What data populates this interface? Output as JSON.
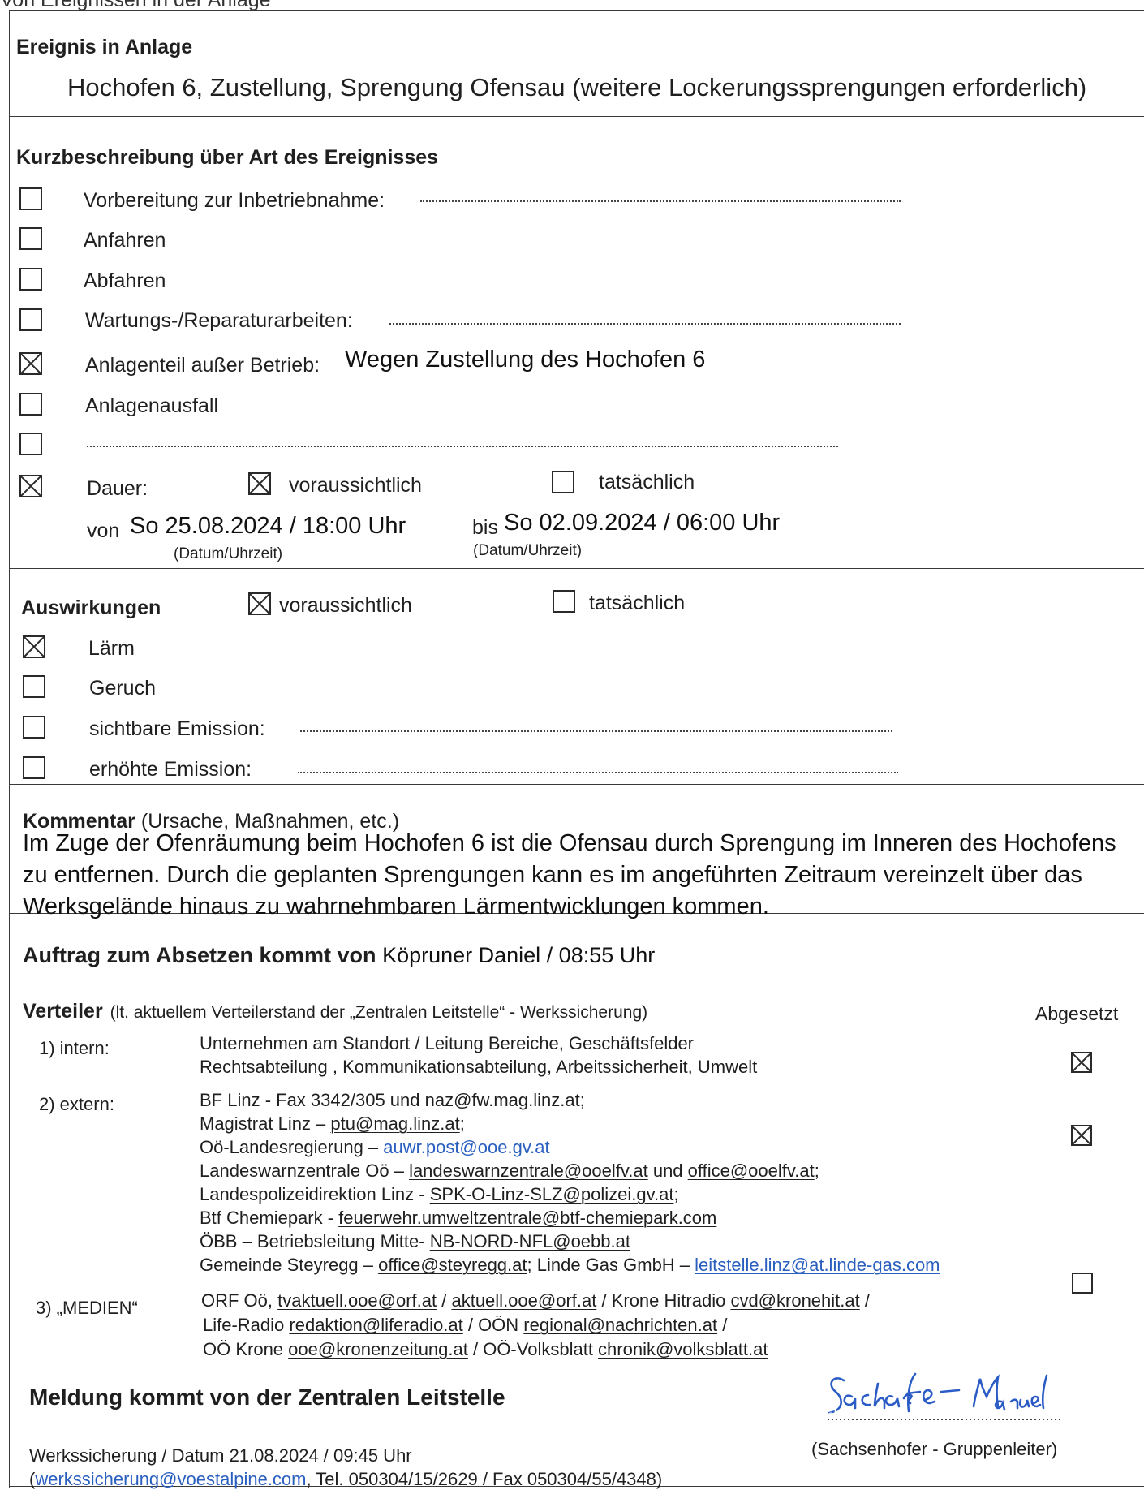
{
  "top_cut": "Von Ereignissen in der Anlage",
  "event": {
    "heading": "Ereignis in Anlage",
    "value": "Hochofen 6, Zustellung, Sprengung Ofensau (weitere Lockerungssprengungen erforderlich)"
  },
  "kurz": {
    "heading": "Kurzbeschreibung über Art des Ereignisses",
    "items": [
      {
        "label": "Vorbereitung zur Inbetriebnahme:",
        "checked": false
      },
      {
        "label": "Anfahren",
        "checked": false
      },
      {
        "label": "Abfahren",
        "checked": false
      },
      {
        "label": "Wartungs-/Reparaturarbeiten:",
        "checked": false
      },
      {
        "label": "Anlagenteil außer Betrieb:",
        "value": "Wegen Zustellung des Hochofen 6",
        "checked": true
      },
      {
        "label": "Anlagenausfall",
        "checked": false
      },
      {
        "label": "",
        "checked": false
      }
    ],
    "dauer": {
      "label": "Dauer:",
      "checked": true,
      "voraus": "voraussichtlich",
      "voraus_checked": true,
      "tats": "tatsächlich",
      "tats_checked": false,
      "von_label": "von",
      "von_value": "So 25.08.2024 / 18:00 Uhr",
      "bis_label": "bis",
      "bis_value": "So 02.09.2024 / 06:00 Uhr",
      "datum_hint": "(Datum/Uhrzeit)",
      "datum_hint2": "(Datum/Uhrzeit)"
    }
  },
  "ausw": {
    "heading": "Auswirkungen",
    "voraus": "voraussichtlich",
    "tats": "tatsächlich",
    "items": [
      {
        "label": "Lärm",
        "checked": true
      },
      {
        "label": "Geruch",
        "checked": false
      },
      {
        "label": "sichtbare Emission:",
        "checked": false
      },
      {
        "label": "erhöhte Emission:",
        "checked": false
      }
    ]
  },
  "kommentar": {
    "heading": "Kommentar",
    "heading_suffix": " (Ursache, Maßnahmen, etc.)",
    "lines": [
      "Im Zuge der Ofenräumung beim Hochofen 6 ist die Ofensau durch Sprengung im Inneren des Hochofens",
      "zu entfernen. Durch die geplanten Sprengungen kann es im angeführten Zeitraum vereinzelt über das",
      "Werksgelände hinaus zu wahrnehmbaren Lärmentwicklungen kommen."
    ]
  },
  "auftrag": {
    "label": "Auftrag zum Absetzen kommt von",
    "value": "Köpruner Daniel / 08:55 Uhr"
  },
  "verteiler": {
    "heading": "Verteiler",
    "subtitle": "(lt. aktuellem Verteilerstand der „Zentralen Leitstelle“ - Werkssicherung)",
    "abgesetzt": "Abgesetzt",
    "intern_label": "1) intern:",
    "intern_lines": [
      "Unternehmen am Standort / Leitung Bereiche, Geschäftsfelder",
      "Rechtsabteilung , Kommunikationsabteilung, Arbeitssicherheit, Umwelt"
    ],
    "extern_label": "2) extern:",
    "e1_text": "BF Linz - Fax 3342/305 und ",
    "e1_mail": "naz@fw.mag.linz.at",
    "e1_end": ";",
    "e2_text": "Magistrat Linz – ",
    "e2_mail": "ptu@mag.linz.at",
    "e2_end": ";",
    "e3_text": "Oö-Landesregierung – ",
    "e3_mail": "auwr.post@ooe.gv.at",
    "e4_text": "Landeswarnzentrale Oö – ",
    "e4_mail": "landeswarnzentrale@ooelfv.at",
    "e4_mid": " und ",
    "e4_mail2": "office@ooelfv.at",
    "e4_end": ";",
    "e5_text": "Landespolizeidirektion Linz - ",
    "e5_mail": "SPK-O-Linz-SLZ@polizei.gv.at",
    "e5_end": ";",
    "e6_text": "Btf Chemiepark - ",
    "e6_mail": "feuerwehr.umweltzentrale@btf-chemiepark.com",
    "e7_text": "ÖBB – Betriebsleitung Mitte-  ",
    "e7_mail": "NB-NORD-NFL@oebb.at",
    "e8_text": "Gemeinde Steyregg – ",
    "e8_mail": "office@steyregg.at",
    "e8_mid": "; Linde Gas GmbH – ",
    "e8_mail2": "leitstelle.linz@at.linde-gas.com",
    "medien_label": "3) „MEDIEN“",
    "m1_text": "ORF Oö, ",
    "m1_mail": "tvaktuell.ooe@orf.at",
    "m1_sep": " / ",
    "m1_mail2": "aktuell.ooe@orf.at",
    "m1_mid": " / Krone Hitradio ",
    "m1_mail3": "cvd@kronehit.at",
    "m1_end": " /",
    "m2_text": "Life-Radio ",
    "m2_mail": "redaktion@liferadio.at",
    "m2_mid": " /  OÖN ",
    "m2_mail2": "regional@nachrichten.at",
    "m2_end": " /",
    "m3_text": "OÖ Krone ",
    "m3_mail": "ooe@kronenzeitung.at",
    "m3_mid": " / OÖ-Volksblatt ",
    "m3_mail2": "chronik@volksblatt.at",
    "checks": {
      "intern": true,
      "extern": true,
      "medien": false
    }
  },
  "meldung": {
    "heading": "Meldung kommt von der Zentralen Leitstelle",
    "signature": "Sachsenhofer Manuel",
    "signer": "(Sachsenhofer - Gruppenleiter)",
    "line1": "Werkssicherung / Datum 21.08.2024 / 09:45 Uhr",
    "line2_open": "(",
    "line2_mail": "werkssicherung@voestalpine.com",
    "line2_rest": ", Tel. 050304/15/2629 / Fax 050304/55/4348)"
  }
}
